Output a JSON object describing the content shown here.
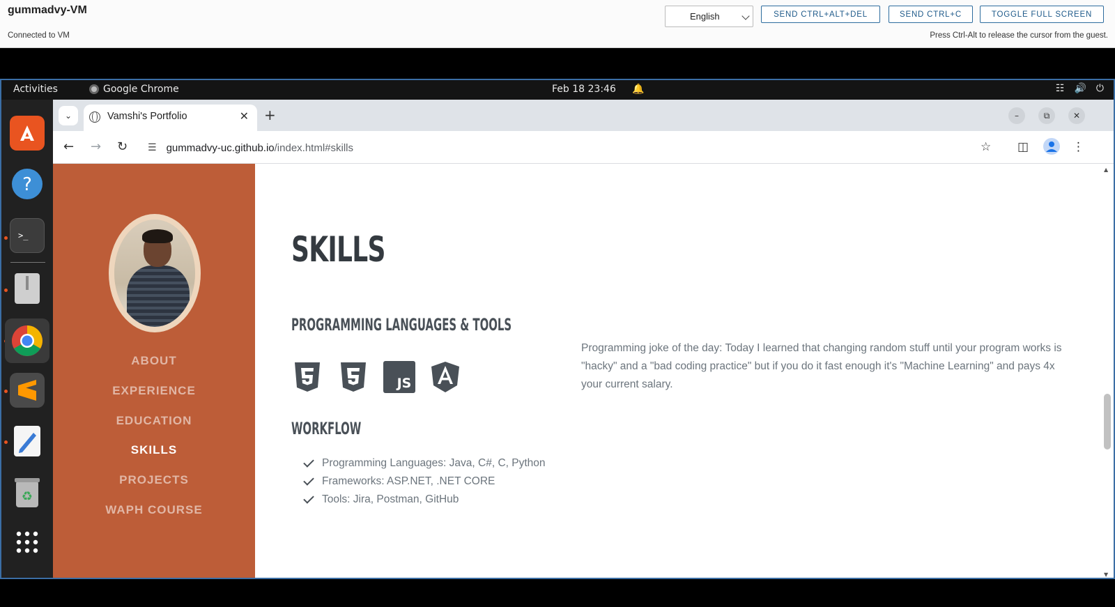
{
  "vm": {
    "title": "gummadvy-VM",
    "status": "Connected to VM",
    "language": "English",
    "buttons": [
      "SEND CTRL+ALT+DEL",
      "SEND CTRL+C",
      "TOGGLE FULL SCREEN"
    ],
    "hint": "Press Ctrl-Alt to release the cursor from the guest."
  },
  "topbar": {
    "activities": "Activities",
    "app": "Google Chrome",
    "clock": "Feb 18  23:46"
  },
  "browser": {
    "tab_title": "Vamshi's Portfolio",
    "url_host": "gummadvy-uc.github.io",
    "url_path": "/index.html#skills"
  },
  "sidebar": {
    "nav": [
      "ABOUT",
      "EXPERIENCE",
      "EDUCATION",
      "SKILLS",
      "PROJECTS",
      "WAPH COURSE"
    ],
    "active": "SKILLS"
  },
  "content": {
    "heading": "SKILLS",
    "subheading_tools": "PROGRAMMING LANGUAGES & TOOLS",
    "skill_icons": [
      "html5-icon",
      "css3-icon",
      "js-icon",
      "angular-icon"
    ],
    "joke": "Programming joke of the day: Today I learned that changing random stuff until your program works is \"hacky\" and a \"bad coding practice\" but if you do it fast enough it's \"Machine Learning\" and pays 4x your current salary.",
    "subheading_workflow": "WORKFLOW",
    "workflow": [
      "Programming Languages: Java, C#, C, Python",
      "Frameworks: ASP.NET, .NET CORE",
      "Tools: Jira, Postman, GitHub"
    ]
  },
  "colors": {
    "sidebar": "#bd5d38",
    "accent_blue": "#2d6c9e"
  }
}
